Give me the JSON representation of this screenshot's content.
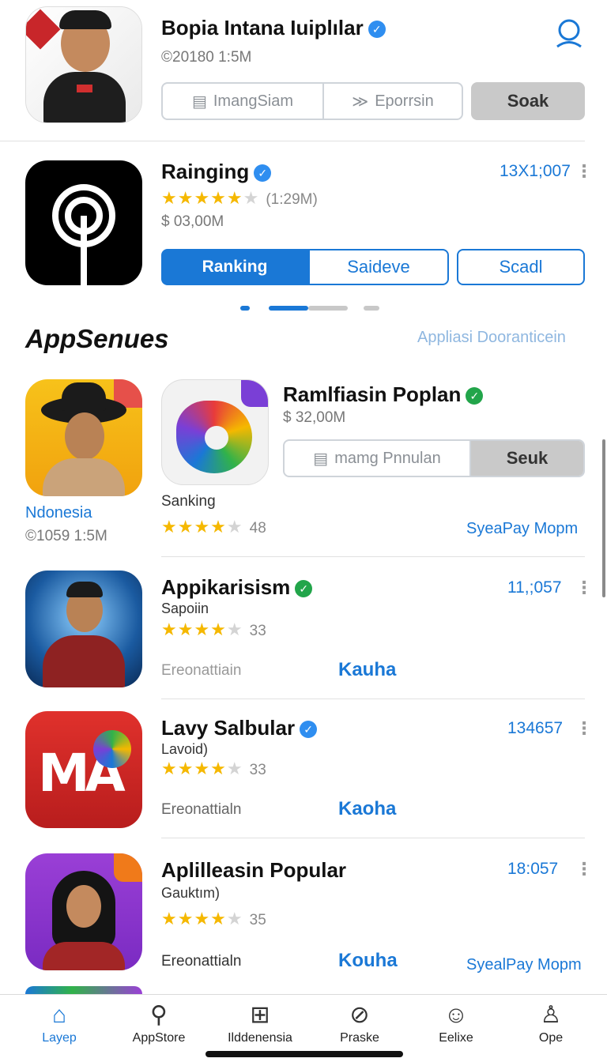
{
  "top_app": {
    "title": "Bopia Intana Iuiplılar",
    "meta": "©20180 1:5M",
    "seg_left": "ImangSiam",
    "seg_right": "Eporrsin",
    "action": "Soak"
  },
  "featured": {
    "title": "Rainging",
    "rating_count": "(1:29M)",
    "price": "$ 03,00M",
    "id": "13Х1;007",
    "btn_primary": "Ranking",
    "btn_second": "Saideve",
    "btn_third": "Scadl"
  },
  "section": {
    "title": "AppSenues",
    "link": "Appliasi Dooranticein"
  },
  "card_left": {
    "label": "Ndonesia",
    "meta": "©1059 1:5M"
  },
  "card_right": {
    "title": "Ramlfiasin Poplan",
    "price": "$ 32,00M",
    "seg_label": "mamg Pnnulan",
    "action": "Seuk",
    "subtitle": "Sanking",
    "rating_count": "48",
    "link": "SyeaPay Mopm"
  },
  "list": [
    {
      "title": "Appikarisism",
      "subtitle": "Sapoiin",
      "rating_count": "33",
      "id": "11,;057",
      "category": "Ereonattiain",
      "action": "Kauha"
    },
    {
      "title": "Lavy Salbular",
      "subtitle": "Lavoid)",
      "rating_count": "33",
      "id": "134657",
      "category": "Ereonattialn",
      "action": "Kaoha"
    },
    {
      "title": "Aplilleasin Popular",
      "subtitle": "Gauktım)",
      "rating_count": "35",
      "id": "18:057",
      "category": "Ereonattialn",
      "action": "Kouha",
      "link": "SyealPay Mopm"
    }
  ],
  "icon_badge_text": "MA",
  "tabs": [
    {
      "label": "Layep",
      "icon": "home-icon"
    },
    {
      "label": "AppStore",
      "icon": "search-icon"
    },
    {
      "label": "Ilddenensia",
      "icon": "grid-icon"
    },
    {
      "label": "Praske",
      "icon": "compass-icon"
    },
    {
      "label": "Eelixe",
      "icon": "account-icon"
    },
    {
      "label": "Ope",
      "icon": "profile-icon"
    }
  ],
  "colors": {
    "accent": "#1a78d6",
    "verified_blue": "#2f8ef0",
    "verified_green": "#22a54a",
    "star": "#f5b800"
  }
}
